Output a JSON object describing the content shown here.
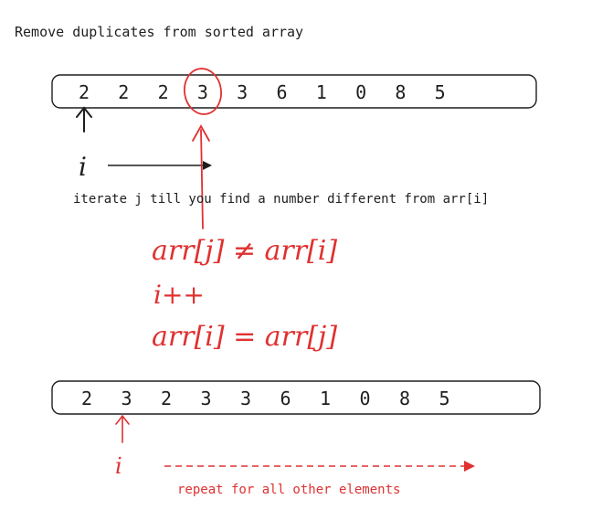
{
  "title": "Remove duplicates from sorted array",
  "top_array": [
    "2",
    "2",
    "2",
    "3",
    "3",
    "6",
    "1",
    "0",
    "8",
    "5"
  ],
  "bottom_array": [
    "2",
    "3",
    "2",
    "3",
    "3",
    "6",
    "1",
    "0",
    "8",
    "5"
  ],
  "pointer_label_top": "i",
  "pointer_label_bottom": "i",
  "iterate_text": "iterate j till you find a number different from arr[i]",
  "condition_line": "arr[j] ≠ arr[i]",
  "increment_line": "i++",
  "assign_line": "arr[i] = arr[j]",
  "repeat_text": "repeat for all other elements",
  "colors": {
    "ink": "#1e1e1e",
    "annotation": "#e03131"
  }
}
